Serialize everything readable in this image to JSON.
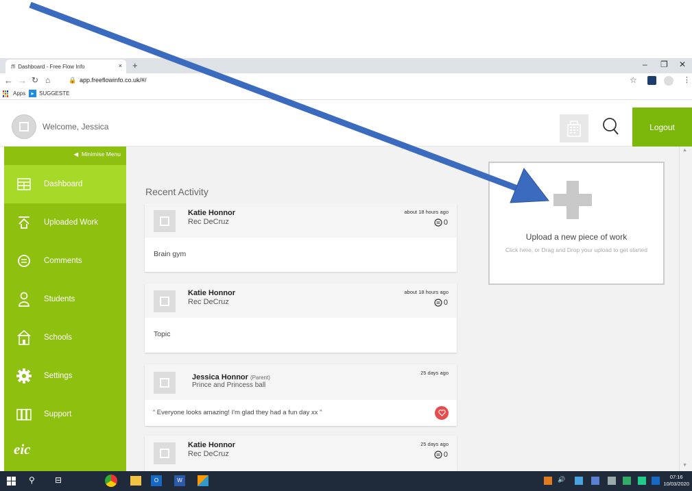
{
  "browser": {
    "tab_title": "Dashboard - Free Flow Info",
    "tab_icon_text": "ffi",
    "tab_close": "×",
    "new_tab": "+",
    "url": "app.freeflowinfo.co.uk/#/",
    "bookmarks": [
      {
        "label": "Apps"
      },
      {
        "label": "SUGGESTE"
      }
    ]
  },
  "header": {
    "welcome": "Welcome, Jessica",
    "logout": "Logout"
  },
  "sidebar": {
    "minimise": "Minimise Menu",
    "items": [
      {
        "label": "Dashboard",
        "icon": "dashboard-icon"
      },
      {
        "label": "Uploaded Work",
        "icon": "upload-icon"
      },
      {
        "label": "Comments",
        "icon": "comment-icon"
      },
      {
        "label": "Students",
        "icon": "students-icon"
      },
      {
        "label": "Schools",
        "icon": "school-icon"
      },
      {
        "label": "Settings",
        "icon": "gear-icon"
      },
      {
        "label": "Support",
        "icon": "support-icon"
      }
    ],
    "logo": "eic"
  },
  "main": {
    "recent_title": "Recent Activity",
    "cards": [
      {
        "name": "Katie Honnor",
        "role": "",
        "sub": "Rec DeCruz",
        "time": "about 18 hours ago",
        "comments": "0",
        "body": "Brain gym"
      },
      {
        "name": "Katie Honnor",
        "role": "",
        "sub": "Rec DeCruz",
        "time": "about 18 hours ago",
        "comments": "0",
        "body": "Topic"
      },
      {
        "name": "Jessica Honnor",
        "role": "(Parent)",
        "sub": "Prince and Princess ball",
        "time": "25 days ago",
        "comments": "",
        "body": "“ Everyone looks amazing! I'm glad they had a fun day xx ”"
      },
      {
        "name": "Katie Honnor",
        "role": "",
        "sub": "Rec DeCruz",
        "time": "25 days ago",
        "comments": "0",
        "body": ""
      }
    ],
    "upload": {
      "title": "Upload a new piece of work",
      "subtitle": "Click here, or Drag and Drop your upload to get started"
    }
  },
  "taskbar": {
    "time": "07:16",
    "date": "10/03/2020"
  },
  "colors": {
    "sidebar": "#8ec10f",
    "active": "#a7d928",
    "logout": "#7cb70b",
    "arrow": "#3b6bbf"
  }
}
